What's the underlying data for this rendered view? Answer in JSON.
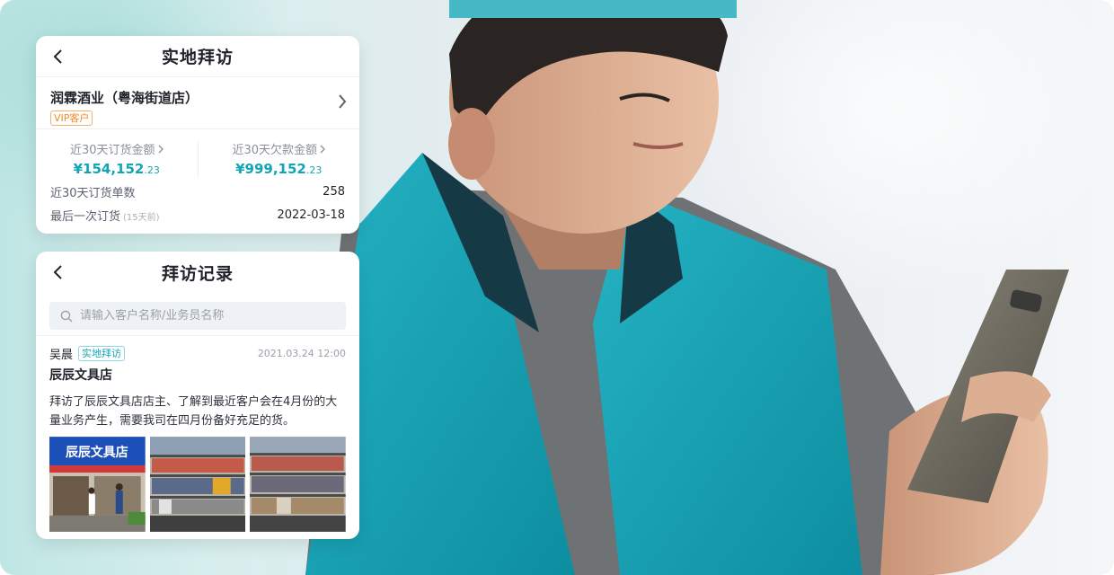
{
  "visit_card": {
    "title": "实地拜访",
    "store": {
      "name": "润霖酒业（粤海街道店）",
      "badge": "VIP客户"
    },
    "stats": [
      {
        "label": "近30天订货金额",
        "currency": "¥",
        "integer": "154,152",
        "decimal": ".23"
      },
      {
        "label": "近30天欠款金额",
        "currency": "¥",
        "integer": "999,152",
        "decimal": ".23"
      }
    ],
    "order_count": {
      "label": "近30天订货单数",
      "value": "258"
    },
    "last_order": {
      "label": "最后一次订货",
      "hint": "(15天前)",
      "value": "2022-03-18"
    }
  },
  "records_card": {
    "title": "拜访记录",
    "search": {
      "placeholder": "请输入客户名称/业务员名称",
      "value": ""
    },
    "record": {
      "person": "吴晨",
      "tag": "实地拜访",
      "time": "2021.03.24 12:00",
      "store": "辰辰文具店",
      "text": "拜访了辰辰文具店店主、了解到最近客户会在4月份的大量业务产生，需要我司在四月份备好充足的货。",
      "storefront_sign": "辰辰文具店"
    }
  },
  "colors": {
    "accent": "#12a5b5",
    "vip": "#f08a24",
    "vest": "#1aa3b3"
  },
  "icons": [
    "back-arrow-icon",
    "chevron-right-icon",
    "search-icon"
  ]
}
